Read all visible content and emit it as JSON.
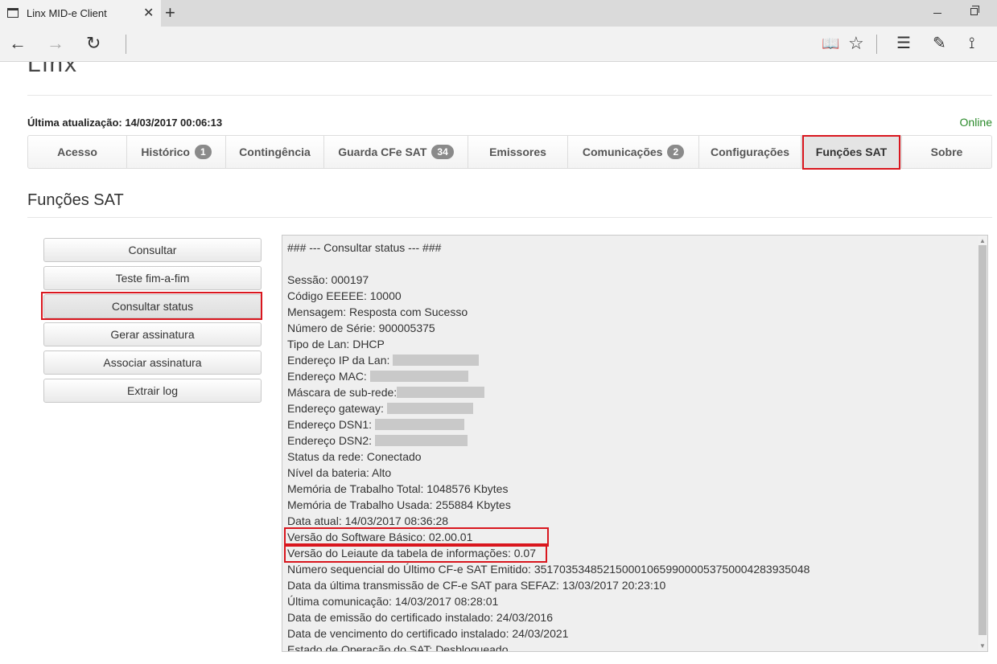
{
  "browser": {
    "tab_title": "Linx MID-e Client",
    "tab_close": "✕",
    "new_tab": "+",
    "back": "←",
    "forward": "→",
    "refresh": "↻",
    "reading_view": "📖",
    "favorite": "☆",
    "hub": "☰",
    "notes": "✎",
    "share": "⟟"
  },
  "header": {
    "logo": "Linx",
    "last_update": "Última atualização: 14/03/2017 00:06:13",
    "status": "Online"
  },
  "tabs": [
    {
      "label": "Acesso",
      "badge": null
    },
    {
      "label": "Histórico",
      "badge": "1"
    },
    {
      "label": "Contingência",
      "badge": null
    },
    {
      "label": "Guarda CFe SAT",
      "badge": "34"
    },
    {
      "label": "Emissores",
      "badge": null
    },
    {
      "label": "Comunicações",
      "badge": "2"
    },
    {
      "label": "Configurações",
      "badge": null
    },
    {
      "label": "Funções SAT",
      "badge": null
    },
    {
      "label": "Sobre",
      "badge": null
    }
  ],
  "section": {
    "title": "Funções SAT"
  },
  "actions": {
    "consultar": "Consultar",
    "teste": "Teste fim-a-fim",
    "consultar_status": "Consultar status",
    "gerar": "Gerar assinatura",
    "associar": "Associar assinatura",
    "extrair": "Extrair log"
  },
  "output": {
    "heading": "### --- Consultar status --- ###",
    "sessao": "Sessão: 000197",
    "codigo": "Código EEEEE: 10000",
    "mensagem": "Mensagem: Resposta com Sucesso",
    "numero_serie": "Número de Série: 900005375",
    "tipo_lan": "Tipo de Lan: DHCP",
    "ip": "Endereço IP da Lan:",
    "mac": "Endereço MAC:",
    "mascara": "Máscara de sub-rede:",
    "gateway": "Endereço gateway:",
    "dsn1": "Endereço DSN1:",
    "dsn2": "Endereço DSN2:",
    "status_rede": "Status da rede: Conectado",
    "bateria": "Nível da bateria: Alto",
    "mem_total": "Memória de Trabalho Total: 1048576 Kbytes",
    "mem_usada": "Memória de Trabalho Usada: 255884 Kbytes",
    "data_atual": "Data atual: 14/03/2017 08:36:28",
    "versao_sw": "Versão do Software Básico: 02.00.01",
    "versao_leiaute": "Versão do Leiaute da tabela de informações: 0.07",
    "numero_seq": "Número sequencial do Último CF-e SAT Emitido: 35170353485215000106599000053750004283935048",
    "ultima_transmissao": "Data da última transmissão de CF-e SAT para SEFAZ: 13/03/2017 20:23:10",
    "ultima_comunicacao": "Última comunicação: 14/03/2017 08:28:01",
    "emissao_cert": "Data de emissão do certificado instalado: 24/03/2016",
    "vencimento_cert": "Data de vencimento do certificado instalado: 24/03/2021",
    "estado": "Estado de Operação do SAT: Desbloqueado"
  },
  "colors": {
    "highlight": "#d9161e",
    "online": "#2a8a2a",
    "badge": "#8a8a8a"
  }
}
